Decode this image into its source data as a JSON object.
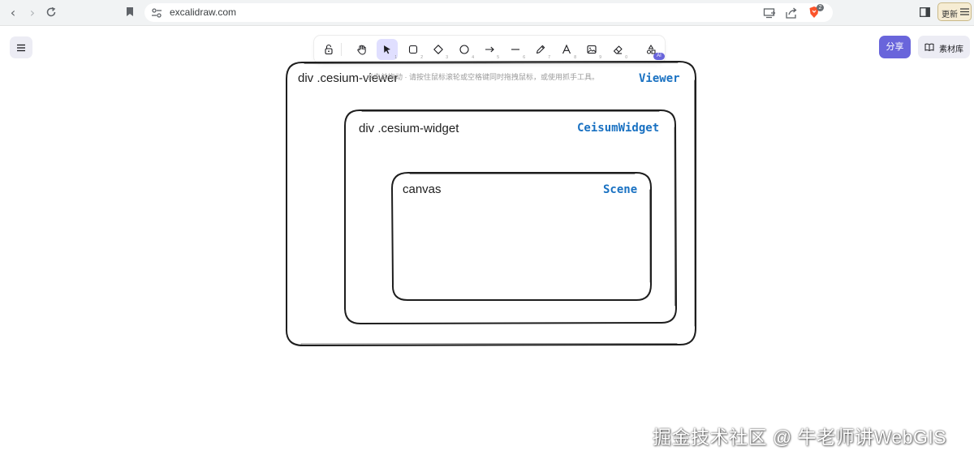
{
  "browser": {
    "url": "excalidraw.com",
    "update_label": "更新",
    "extension_badge": "2"
  },
  "toolbar": {
    "tools": [
      {
        "name": "lock",
        "key": ""
      },
      {
        "name": "hand",
        "key": ""
      },
      {
        "name": "selection",
        "key": "1"
      },
      {
        "name": "rectangle",
        "key": "2"
      },
      {
        "name": "diamond",
        "key": "3"
      },
      {
        "name": "ellipse",
        "key": "4"
      },
      {
        "name": "arrow",
        "key": "5"
      },
      {
        "name": "line",
        "key": "6"
      },
      {
        "name": "draw",
        "key": "7"
      },
      {
        "name": "text",
        "key": "8"
      },
      {
        "name": "image",
        "key": "9"
      },
      {
        "name": "eraser",
        "key": "0"
      }
    ],
    "ai_badge": "AI",
    "hint": "点击并拖动 · 请按住鼠标滚轮或空格键同时拖拽鼠标，或使用抓手工具。"
  },
  "header": {
    "share_label": "分享",
    "library_label": "素材库"
  },
  "diagram": {
    "viewer": {
      "label": "div  .cesium-viewer",
      "class_name": "Viewer"
    },
    "widget": {
      "label": "div  .cesium-widget",
      "class_name": "CeisumWidget"
    },
    "canvas": {
      "label": "canvas",
      "class_name": "Scene"
    }
  },
  "watermark": "掘金技术社区 @ 牛老师讲WebGIS",
  "colors": {
    "accent": "#6965db",
    "accent_light": "#e0dfff",
    "class_name": "#1971c2",
    "stroke": "#1e1e1e"
  }
}
